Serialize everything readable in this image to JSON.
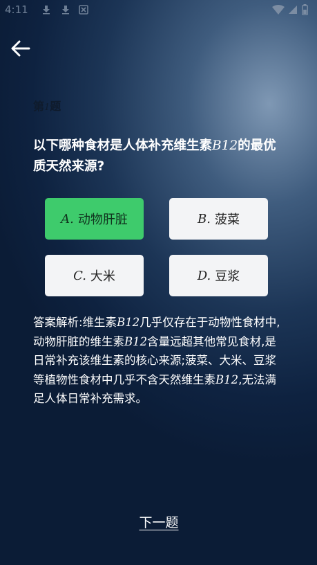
{
  "status_bar": {
    "time": "4:11"
  },
  "question": {
    "number_prefix": "第",
    "number": "1",
    "number_suffix": "题",
    "text_before": "以下哪种食材是人体补充维生素",
    "text_vitamin": "B12",
    "text_after": "的最优质天然来源?"
  },
  "options": [
    {
      "letter": "A.",
      "text": "动物肝脏",
      "state": "correct"
    },
    {
      "letter": "B.",
      "text": "菠菜",
      "state": "normal"
    },
    {
      "letter": "C.",
      "text": "大米",
      "state": "normal"
    },
    {
      "letter": "D.",
      "text": "豆浆",
      "state": "normal"
    }
  ],
  "explanation": {
    "p1": "答案解析:维生素",
    "v1": "B12",
    "p2": "几乎仅存在于动物性食材中,动物肝脏的维生素",
    "v2": "B12",
    "p3": "含量远超其他常见食材,是日常补充该维生素的核心来源;菠菜、大米、豆浆等植物性食材中几乎不含天然维生素",
    "v3": "B12",
    "p4": ",无法满足人体日常补充需求。"
  },
  "next_label": "下一题",
  "colors": {
    "correct": "#3ecb6c",
    "option_bg": "#f3f4f6",
    "background": "#1c3556"
  }
}
